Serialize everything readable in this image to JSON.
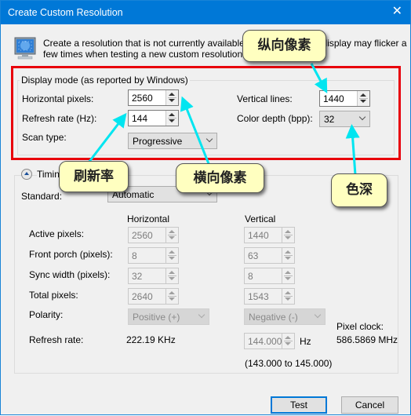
{
  "window": {
    "title": "Create Custom Resolution",
    "close_icon": "close-icon"
  },
  "intro": {
    "icon": "monitor-icon",
    "text_line1": "Create a resolution that is not currently available in Windows. Your display may flicker a",
    "text_line2": "few times when testing a new custom resolution."
  },
  "display_mode": {
    "title": "Display mode (as reported by Windows)",
    "horizontal_pixels_label": "Horizontal pixels:",
    "horizontal_pixels_value": "2560",
    "refresh_rate_label": "Refresh rate (Hz):",
    "refresh_rate_value": "144",
    "scan_type_label": "Scan type:",
    "scan_type_value": "Progressive",
    "vertical_lines_label": "Vertical lines:",
    "vertical_lines_value": "1440",
    "color_depth_label": "Color depth (bpp):",
    "color_depth_value": "32"
  },
  "timing": {
    "toggle_icon": "collapse-up-icon",
    "title": "Timing",
    "standard_label": "Standard:",
    "standard_value": "Automatic",
    "col_horizontal": "Horizontal",
    "col_vertical": "Vertical",
    "rows": [
      {
        "label": "Active pixels:",
        "h": "2560",
        "v": "1440"
      },
      {
        "label": "Front porch (pixels):",
        "h": "8",
        "v": "63"
      },
      {
        "label": "Sync width (pixels):",
        "h": "32",
        "v": "8"
      },
      {
        "label": "Total pixels:",
        "h": "2640",
        "v": "1543"
      }
    ],
    "polarity_label": "Polarity:",
    "polarity_h": "Positive (+)",
    "polarity_v": "Negative (-)",
    "refresh_label": "Refresh rate:",
    "refresh_h": "222.19 KHz",
    "refresh_v": "144.000",
    "refresh_v_unit": "Hz",
    "refresh_range": "(143.000 to 145.000)",
    "pixel_clock_label": "Pixel clock:",
    "pixel_clock_value": "586.5869 MHz"
  },
  "buttons": {
    "test": "Test",
    "cancel": "Cancel"
  },
  "annotations": {
    "vertical_pixels": "纵向像素",
    "refresh_rate": "刷新率",
    "horizontal_pixels": "横向像素",
    "color_depth": "色深",
    "accent_color": "#00e5f0",
    "highlight_color": "#e8000b"
  }
}
